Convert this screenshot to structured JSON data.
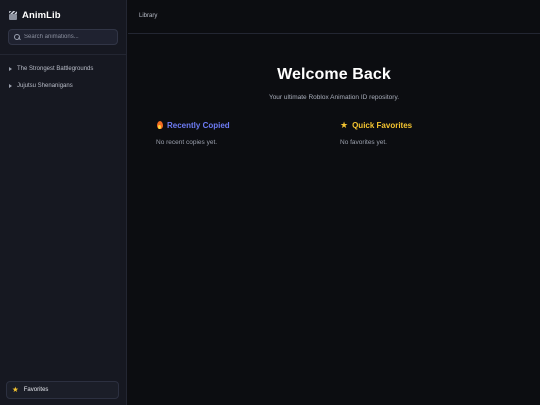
{
  "sidebar": {
    "brand": "AnimLib",
    "search": {
      "placeholder": "Search animations...",
      "value": ""
    },
    "items": [
      {
        "label": "The Strongest Battlegrounds"
      },
      {
        "label": "Jujutsu Shenanigans"
      }
    ],
    "favorites_label": "Favorites"
  },
  "header": {
    "breadcrumb": "Library"
  },
  "main": {
    "title": "Welcome Back",
    "subtitle": "Your ultimate Roblox Animation ID repository.",
    "recent": {
      "title": "Recently Copied",
      "empty": "No recent copies yet.",
      "icon": "flame-icon"
    },
    "favorites": {
      "title": "Quick Favorites",
      "empty": "No favorites yet.",
      "icon": "star-icon"
    }
  },
  "colors": {
    "background": "#0c0d11",
    "sidebar": "#161821",
    "accent_blue": "#6e7cf5",
    "accent_yellow": "#f4c430"
  }
}
